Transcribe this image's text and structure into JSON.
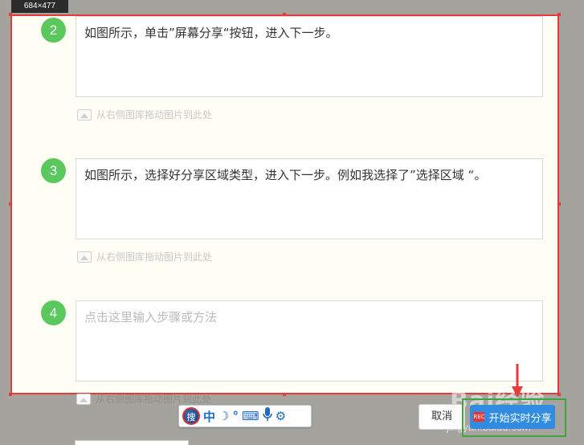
{
  "selection": {
    "size_label": "684×477"
  },
  "steps": [
    {
      "number": "2",
      "text": "如图所示，单击”屏幕分享“按钮，进入下一步。",
      "is_placeholder": false
    },
    {
      "number": "3",
      "text": "如图所示，选择好分享区域类型，进入下一步。例如我选择了”选择区域 “。",
      "is_placeholder": false
    },
    {
      "number": "4",
      "text": "点击这里输入步骤或方法",
      "is_placeholder": true
    }
  ],
  "image_hint": "从右侧图库拖动图片到此处",
  "side_controls": {
    "move": "✥",
    "delete": "×",
    "add": "+"
  },
  "ime": {
    "logo": "搜",
    "mode": "中",
    "moon": "☽",
    "punct": "°",
    "keyboard": "⌨",
    "mic": "🎤",
    "settings": "⚙"
  },
  "toolbar": {
    "cancel_label": "取消",
    "share_label": "开始实时分享",
    "rec_icon": "REC"
  },
  "watermark": {
    "title": "Bai经验",
    "sub": "jingyan.baidu.com"
  },
  "colors": {
    "selection_border": "#e43c3c",
    "step_green": "#5ac85c",
    "share_blue": "#2f8ce0",
    "highlight_green": "#3fa63f"
  }
}
